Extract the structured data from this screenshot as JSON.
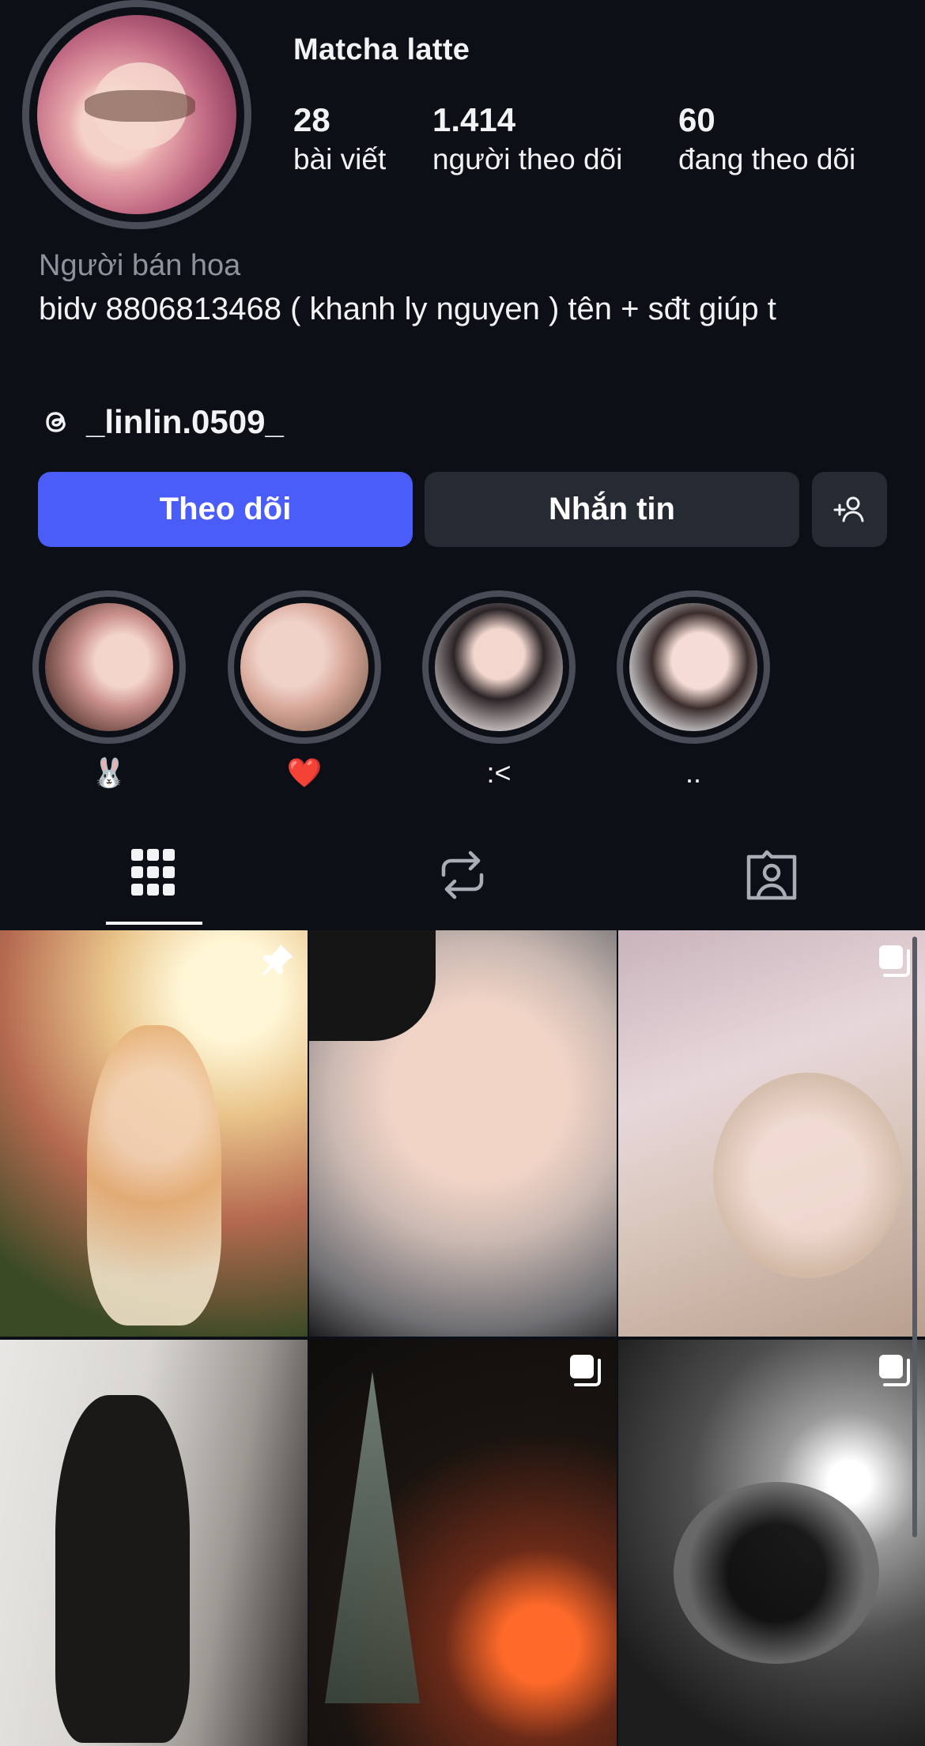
{
  "profile": {
    "username": "Matcha latte",
    "stats": {
      "posts": {
        "count": "28",
        "label": "bài viết"
      },
      "followers": {
        "count": "1.414",
        "label": "người theo dõi"
      },
      "following": {
        "count": "60",
        "label": "đang theo dõi"
      }
    },
    "category": "Người bán hoa",
    "bio": "bidv 8806813468 ( khanh ly nguyen ) tên + sđt giúp t",
    "threads_handle": "_linlin.0509_"
  },
  "actions": {
    "follow_label": "Theo dõi",
    "message_label": "Nhắn tin",
    "add_icon": "add-user-icon"
  },
  "highlights": [
    {
      "label": "🐰"
    },
    {
      "label": "❤️"
    },
    {
      "label": ":<"
    },
    {
      "label": ".."
    }
  ],
  "tabs": [
    {
      "icon": "grid-icon",
      "active": true
    },
    {
      "icon": "repost-icon",
      "active": false
    },
    {
      "icon": "tagged-icon",
      "active": false
    }
  ],
  "posts": [
    {
      "badge": "pin-icon"
    },
    {
      "badge": ""
    },
    {
      "badge": "carousel-icon"
    },
    {
      "badge": ""
    },
    {
      "badge": "carousel-icon"
    },
    {
      "badge": "carousel-icon"
    }
  ],
  "colors": {
    "background": "#0c0f16",
    "follow_button": "#4a5df9",
    "secondary_button": "#262a33",
    "text": "#f2f3f5",
    "muted_text": "#8e929c"
  }
}
